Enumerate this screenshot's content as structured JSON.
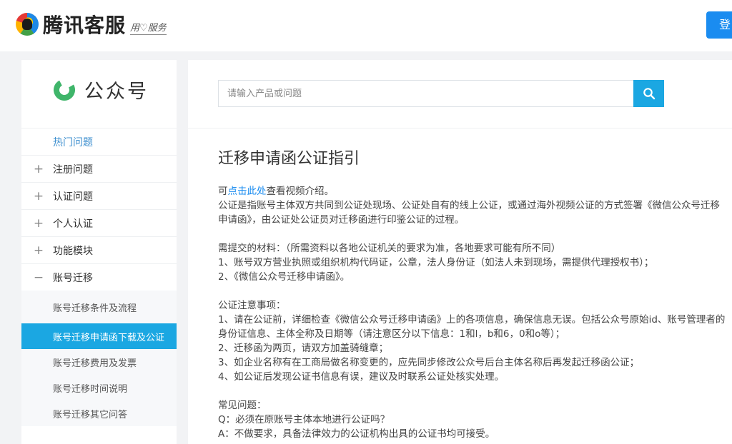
{
  "header": {
    "logo_text": "腾讯客服",
    "slogan": "用♡服务",
    "login_label": "登"
  },
  "sidebar": {
    "product_name": "公众号",
    "hot_label": "热门问题",
    "categories": [
      {
        "toggle": "+",
        "label": "注册问题"
      },
      {
        "toggle": "+",
        "label": "认证问题"
      },
      {
        "toggle": "+",
        "label": "个人认证"
      },
      {
        "toggle": "+",
        "label": "功能模块"
      },
      {
        "toggle": "−",
        "label": "账号迁移"
      }
    ],
    "sub_items": [
      "账号迁移条件及流程",
      "账号迁移申请函下载及公证",
      "账号迁移费用及发票",
      "账号迁移时间说明",
      "账号迁移其它问答"
    ]
  },
  "search": {
    "placeholder": "请输入产品或问题"
  },
  "article": {
    "title": "迁移申请函公证指引",
    "intro_prefix": "可",
    "intro_link": "点击此处",
    "intro_suffix": "查看视频介绍。",
    "p1": "公证是指账号主体双方共同到公证处现场、公证处自有的线上公证，或通过海外视频公证的方式签署《微信公众号迁移申请函》，由公证处公证员对迁移函进行印鉴公证的过程。",
    "materials_title": "需提交的材料：（所需资料以各地公证机关的要求为准，各地要求可能有所不同）",
    "materials_1": "1、账号双方营业执照或组织机构代码证，公章，法人身份证（如法人未到现场，需提供代理授权书）；",
    "materials_2": "2、《微信公众号迁移申请函》。",
    "notes_title": "公证注意事项：",
    "notes_1": "1、请在公证前，详细检查《微信公众号迁移申请函》上的各项信息，确保信息无误。包括公众号原始id、账号管理者的身份证信息、主体全称及日期等（请注意区分以下信息：1和l，b和6，0和o等）；",
    "notes_2": "2、迁移函为两页，请双方加盖骑缝章；",
    "notes_3": "3、如企业名称有在工商局做名称变更的，应先同步修改公众号后台主体名称后再发起迁移函公证；",
    "notes_4": "4、如公证后发现公证书信息有误，建议及时联系公证处核实处理。",
    "faq_title": "常见问题：",
    "faq_q": "Q：必须在原账号主体本地进行公证吗？",
    "faq_a": "A：不做要求，具备法律效力的公证机构出具的公证书均可接受。"
  },
  "colors": {
    "accent": "#1ba7e2",
    "link": "#1a8cf0",
    "brand_green": "#3fb56a"
  }
}
